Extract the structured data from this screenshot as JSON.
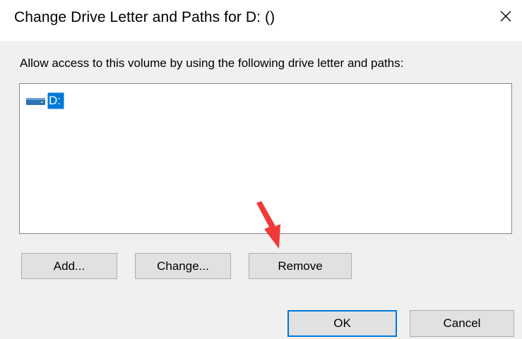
{
  "dialog": {
    "title": "Change Drive Letter and Paths for D: ()",
    "description": "Allow access to this volume by using the following drive letter and paths:"
  },
  "list": {
    "items": [
      {
        "label": "D:",
        "icon": "drive-icon",
        "selected": true
      }
    ]
  },
  "buttons": {
    "add": "Add...",
    "change": "Change...",
    "remove": "Remove",
    "ok": "OK",
    "cancel": "Cancel"
  },
  "colors": {
    "selection": "#0078d7",
    "arrow": "#f03a3a"
  }
}
